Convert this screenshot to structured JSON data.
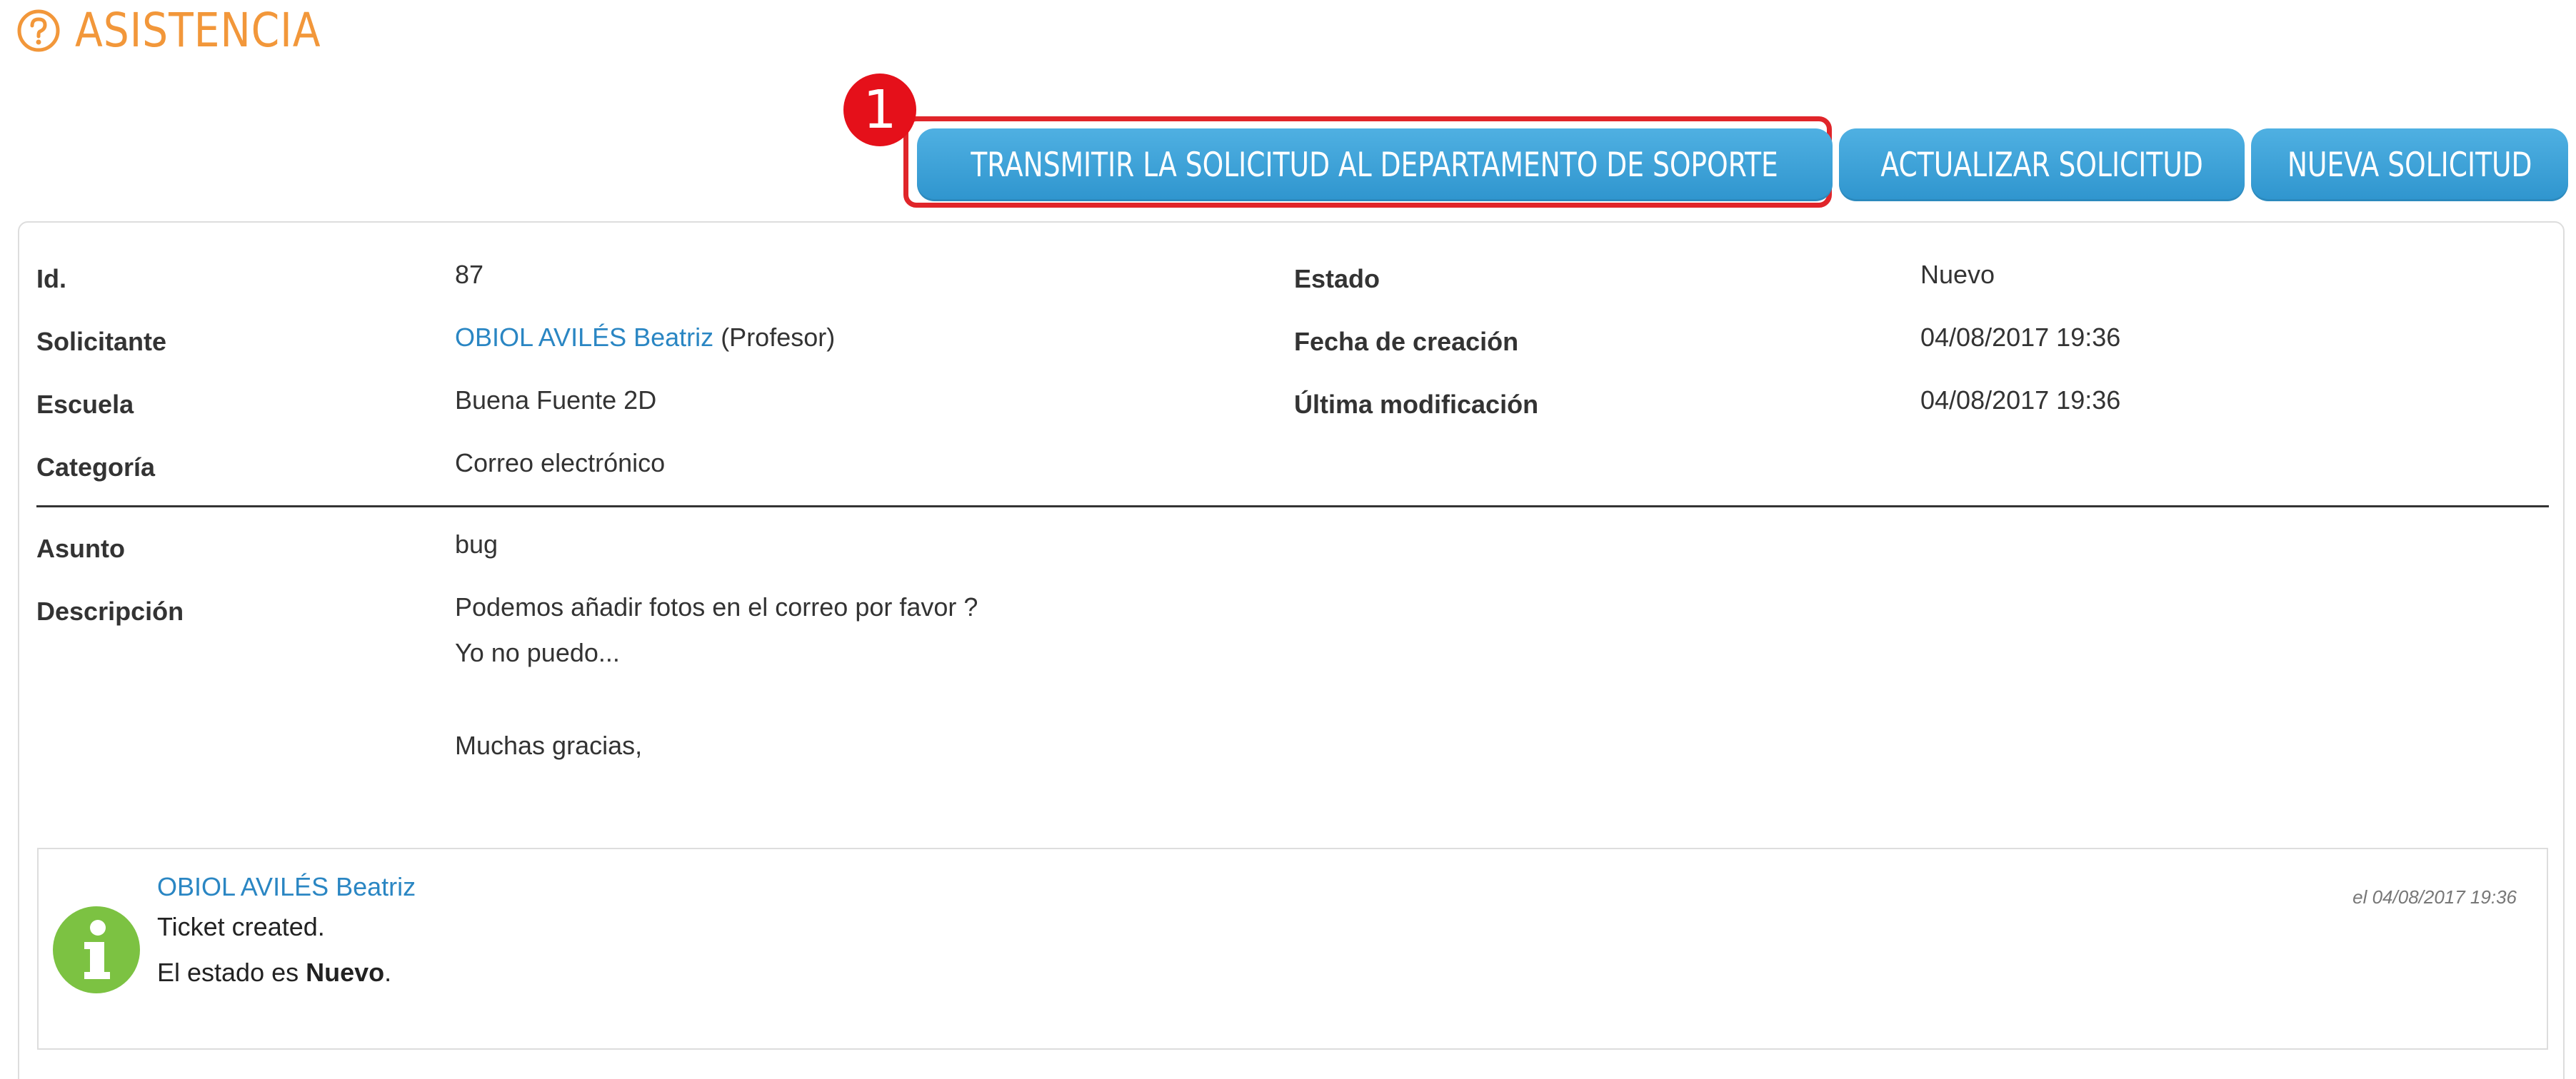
{
  "header": {
    "title": "ASISTENCIA",
    "icon": "help-circle-icon",
    "accent_color": "#f2973a"
  },
  "step_badge": "1",
  "actions": {
    "transmit_label": "TRANSMITIR LA SOLICITUD AL DEPARTAMENTO DE SOPORTE",
    "update_label": "ACTUALIZAR SOLICITUD",
    "new_label": "NUEVA SOLICITUD",
    "button_color": "#3aa3d8",
    "highlight_color": "#e0252a"
  },
  "ticket": {
    "id_label": "Id.",
    "id_value": "87",
    "requester_label": "Solicitante",
    "requester_name": "OBIOL AVILÉS Beatriz",
    "requester_role": "(Profesor)",
    "school_label": "Escuela",
    "school_value": "Buena Fuente 2D",
    "category_label": "Categoría",
    "category_value": "Correo electrónico",
    "status_label": "Estado",
    "status_value": "Nuevo",
    "created_label": "Fecha de creación",
    "created_value": "04/08/2017 19:36",
    "modified_label": "Última modificación",
    "modified_value": "04/08/2017 19:36",
    "subject_label": "Asunto",
    "subject_value": "bug",
    "description_label": "Descripción",
    "description_lines": [
      "Podemos añadir fotos en el correo por favor ?",
      "Yo no puedo...",
      "Muchas gracias,"
    ]
  },
  "history": {
    "icon": "info-icon",
    "icon_color": "#7cc242",
    "author": "OBIOL AVILÉS Beatriz",
    "date": "el 04/08/2017 19:36",
    "line1": "Ticket created.",
    "line2_prefix": "El estado es ",
    "line2_status": "Nuevo",
    "line2_suffix": "."
  }
}
